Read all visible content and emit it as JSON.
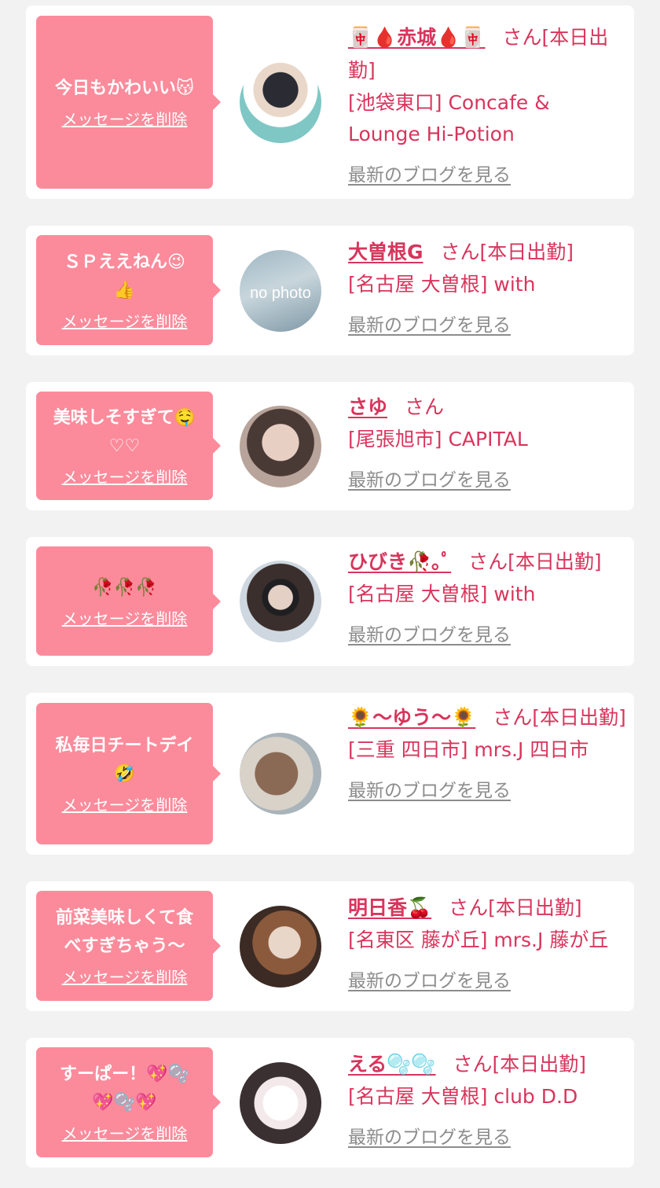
{
  "delete_label": "メッセージを削除",
  "san_label": "さん",
  "blog_label": "最新のブログを見る",
  "colors": {
    "page_bg": "#f2f2f2",
    "card_bg": "#ffffff",
    "bubble_bg": "#fb8b9b",
    "accent": "#d8355c",
    "link_gray": "#8c8c8c"
  },
  "entries": [
    {
      "message": "今日もかわいい😽",
      "name": "🀄🩸赤城🩸🀄",
      "status": "[本日出勤]",
      "shop": "[池袋東口] Concafe & Lounge Hi-Potion",
      "avatar": "photo"
    },
    {
      "message": "ＳＰええねん😉\n👍",
      "name": "大曽根G",
      "status": "[本日出勤]",
      "shop": "[名古屋 大曽根] with",
      "avatar": "no photo"
    },
    {
      "message": "美味しそすぎて🤤\n♡♡",
      "name": "さゆ",
      "status": "",
      "shop": "[尾張旭市] CAPITAL",
      "avatar": "photo"
    },
    {
      "message": "🥀🥀🥀",
      "name": "ひびき🥀｡ﾟ",
      "status": "[本日出勤]",
      "shop": "[名古屋 大曽根] with",
      "avatar": "photo"
    },
    {
      "message": "私毎日チートデイ\n🤣",
      "name": "🌻〜ゆう〜🌻",
      "status": "[本日出勤]",
      "shop": "[三重 四日市] mrs.J 四日市",
      "avatar": "photo"
    },
    {
      "message": "前菜美味しくて食\nべすぎちゃう〜",
      "name": "明日香🍒",
      "status": "[本日出勤]",
      "shop": "[名東区 藤が丘] mrs.J 藤が丘",
      "avatar": "photo"
    },
    {
      "message": "すーぱー！💖🫧\n💖🫧💖",
      "name": "える🫧🫧",
      "status": "[本日出勤]",
      "shop": "[名古屋 大曽根] club D.D",
      "avatar": "photo"
    }
  ]
}
